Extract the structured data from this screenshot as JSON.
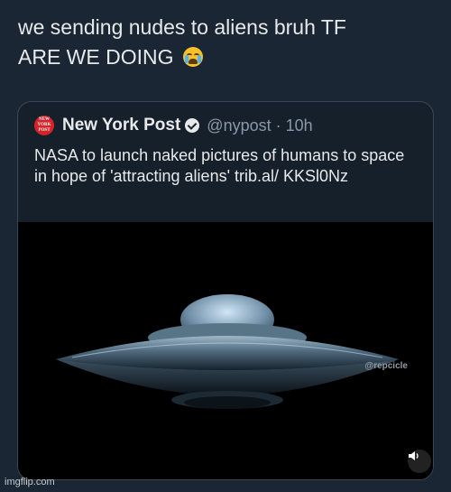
{
  "post": {
    "text_line1": "we sending nudes to aliens bruh TF",
    "text_line2": "ARE WE DOING",
    "emoji": "loudly-crying-face-emoji"
  },
  "quoted_tweet": {
    "logo_text": "NEW YORK POST",
    "author_name": "New York Post",
    "handle_time": "@nypost · 10h",
    "text": "NASA to launch naked pictures of humans to space in hope of 'attracting aliens' trib.al/ KKSl0Nz",
    "media": {
      "description_icon": "ufo-image",
      "watermark": "@repcicle",
      "sound_icon": "speaker-icon"
    }
  },
  "footer": {
    "watermark": "imgflip.com"
  },
  "colors": {
    "background": "#1a2633",
    "card_background": "#15202b",
    "text": "#e7e9ea",
    "muted": "#8b98a5",
    "brand_red": "#d6232a"
  }
}
